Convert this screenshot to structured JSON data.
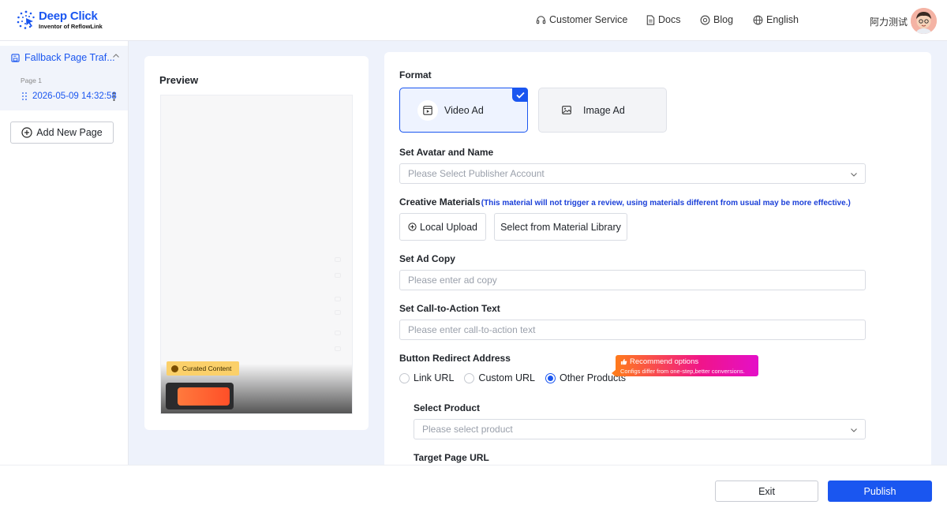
{
  "header": {
    "logo_title": "Deep Click",
    "logo_subtitle": "Inventor of ReflowLink",
    "nav": [
      {
        "label": "Customer Service",
        "icon": "headset-icon"
      },
      {
        "label": "Docs",
        "icon": "document-icon"
      },
      {
        "label": "Blog",
        "icon": "blog-icon"
      },
      {
        "label": "English",
        "icon": "globe-icon"
      }
    ],
    "user_name": "阿力测试"
  },
  "sidebar": {
    "group_label": "Fallback Page Traf...",
    "page_label": "Page 1",
    "page_item": "2026-05-09 14:32:58",
    "add_page_label": "Add New Page"
  },
  "preview": {
    "title": "Preview",
    "curated_label": "Curated Content"
  },
  "form": {
    "format_label": "Format",
    "format_options": [
      {
        "label": "Video Ad",
        "selected": true
      },
      {
        "label": "Image Ad",
        "selected": false
      }
    ],
    "avatar_label": "Set Avatar and Name",
    "avatar_placeholder": "Please Select Publisher Account",
    "materials_label": "Creative Materials",
    "materials_note": "(This material will not trigger a review, using materials different from usual may be more effective.)",
    "local_upload": "Local Upload",
    "material_library": "Select from Material Library",
    "ad_copy_label": "Set Ad Copy",
    "ad_copy_placeholder": "Please enter ad copy",
    "cta_label": "Set Call-to-Action Text",
    "cta_placeholder": "Please enter call-to-action text",
    "redirect_label": "Button Redirect Address",
    "redirect_options": [
      {
        "label": "Link URL",
        "selected": false
      },
      {
        "label": "Custom URL",
        "selected": false
      },
      {
        "label": "Other Products",
        "selected": true
      }
    ],
    "recommend_title": "Recommend options",
    "recommend_sub": "Configs differ from one-step,better conversions.",
    "product_label": "Select Product",
    "product_placeholder": "Please select product",
    "target_label": "Target Page URL"
  },
  "footer": {
    "exit_label": "Exit",
    "publish_label": "Publish"
  },
  "colors": {
    "accent": "#1a56f0",
    "background": "#eef2fb",
    "recommend_gradient": [
      "#ff7b1c",
      "#e410c8"
    ]
  }
}
